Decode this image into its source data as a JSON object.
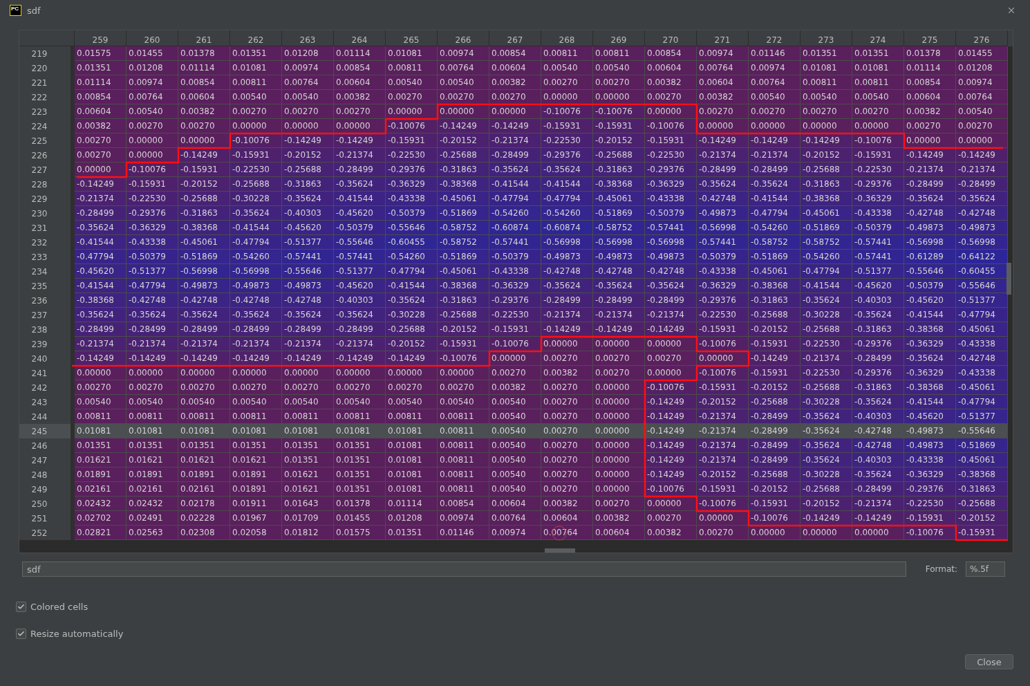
{
  "window": {
    "logo_text": "PC",
    "title": "sdf"
  },
  "table": {
    "columns": [
      "259",
      "260",
      "261",
      "262",
      "263",
      "264",
      "265",
      "266",
      "267",
      "268",
      "269",
      "270",
      "271",
      "272",
      "273",
      "274",
      "275",
      "276"
    ],
    "rows": [
      {
        "label": "219",
        "selected": false,
        "cells": [
          "0.01575",
          "0.01455",
          "0.01378",
          "0.01351",
          "0.01208",
          "0.01114",
          "0.01081",
          "0.00974",
          "0.00854",
          "0.00811",
          "0.00811",
          "0.00854",
          "0.00974",
          "0.01146",
          "0.01351",
          "0.01351",
          "0.01378",
          "0.01455"
        ]
      },
      {
        "label": "220",
        "selected": false,
        "cells": [
          "0.01351",
          "0.01208",
          "0.01114",
          "0.01081",
          "0.00974",
          "0.00854",
          "0.00811",
          "0.00764",
          "0.00604",
          "0.00540",
          "0.00540",
          "0.00604",
          "0.00764",
          "0.00974",
          "0.01081",
          "0.01081",
          "0.01114",
          "0.01208"
        ]
      },
      {
        "label": "221",
        "selected": false,
        "cells": [
          "0.01114",
          "0.00974",
          "0.00854",
          "0.00811",
          "0.00764",
          "0.00604",
          "0.00540",
          "0.00540",
          "0.00382",
          "0.00270",
          "0.00270",
          "0.00382",
          "0.00604",
          "0.00764",
          "0.00811",
          "0.00811",
          "0.00854",
          "0.00974"
        ]
      },
      {
        "label": "222",
        "selected": false,
        "cells": [
          "0.00854",
          "0.00764",
          "0.00604",
          "0.00540",
          "0.00540",
          "0.00382",
          "0.00270",
          "0.00270",
          "0.00270",
          "0.00000",
          "0.00000",
          "0.00270",
          "0.00382",
          "0.00540",
          "0.00540",
          "0.00540",
          "0.00604",
          "0.00764"
        ]
      },
      {
        "label": "223",
        "selected": false,
        "cells": [
          "0.00604",
          "0.00540",
          "0.00382",
          "0.00270",
          "0.00270",
          "0.00270",
          "0.00000",
          "0.00000",
          "0.00000",
          "-0.10076",
          "-0.10076",
          "0.00000",
          "0.00270",
          "0.00270",
          "0.00270",
          "0.00270",
          "0.00382",
          "0.00540"
        ]
      },
      {
        "label": "224",
        "selected": false,
        "cells": [
          "0.00382",
          "0.00270",
          "0.00270",
          "0.00000",
          "0.00000",
          "0.00000",
          "-0.10076",
          "-0.14249",
          "-0.14249",
          "-0.15931",
          "-0.15931",
          "-0.10076",
          "0.00000",
          "0.00000",
          "0.00000",
          "0.00000",
          "0.00270",
          "0.00270"
        ]
      },
      {
        "label": "225",
        "selected": false,
        "cells": [
          "0.00270",
          "0.00000",
          "0.00000",
          "-0.10076",
          "-0.14249",
          "-0.14249",
          "-0.15931",
          "-0.20152",
          "-0.21374",
          "-0.22530",
          "-0.20152",
          "-0.15931",
          "-0.14249",
          "-0.14249",
          "-0.14249",
          "-0.10076",
          "0.00000",
          "0.00000"
        ]
      },
      {
        "label": "226",
        "selected": false,
        "cells": [
          "0.00270",
          "0.00000",
          "-0.14249",
          "-0.15931",
          "-0.20152",
          "-0.21374",
          "-0.22530",
          "-0.25688",
          "-0.28499",
          "-0.29376",
          "-0.25688",
          "-0.22530",
          "-0.21374",
          "-0.21374",
          "-0.20152",
          "-0.15931",
          "-0.14249",
          "-0.14249"
        ]
      },
      {
        "label": "227",
        "selected": false,
        "cells": [
          "0.00000",
          "-0.10076",
          "-0.15931",
          "-0.22530",
          "-0.25688",
          "-0.28499",
          "-0.29376",
          "-0.31863",
          "-0.35624",
          "-0.35624",
          "-0.31863",
          "-0.29376",
          "-0.28499",
          "-0.28499",
          "-0.25688",
          "-0.22530",
          "-0.21374",
          "-0.21374"
        ]
      },
      {
        "label": "228",
        "selected": false,
        "cells": [
          "-0.14249",
          "-0.15931",
          "-0.20152",
          "-0.25688",
          "-0.31863",
          "-0.35624",
          "-0.36329",
          "-0.38368",
          "-0.41544",
          "-0.41544",
          "-0.38368",
          "-0.36329",
          "-0.35624",
          "-0.35624",
          "-0.31863",
          "-0.29376",
          "-0.28499",
          "-0.28499"
        ]
      },
      {
        "label": "229",
        "selected": false,
        "cells": [
          "-0.21374",
          "-0.22530",
          "-0.25688",
          "-0.30228",
          "-0.35624",
          "-0.41544",
          "-0.43338",
          "-0.45061",
          "-0.47794",
          "-0.47794",
          "-0.45061",
          "-0.43338",
          "-0.42748",
          "-0.41544",
          "-0.38368",
          "-0.36329",
          "-0.35624",
          "-0.35624"
        ]
      },
      {
        "label": "230",
        "selected": false,
        "cells": [
          "-0.28499",
          "-0.29376",
          "-0.31863",
          "-0.35624",
          "-0.40303",
          "-0.45620",
          "-0.50379",
          "-0.51869",
          "-0.54260",
          "-0.54260",
          "-0.51869",
          "-0.50379",
          "-0.49873",
          "-0.47794",
          "-0.45061",
          "-0.43338",
          "-0.42748",
          "-0.42748"
        ]
      },
      {
        "label": "231",
        "selected": false,
        "cells": [
          "-0.35624",
          "-0.36329",
          "-0.38368",
          "-0.41544",
          "-0.45620",
          "-0.50379",
          "-0.55646",
          "-0.58752",
          "-0.60874",
          "-0.60874",
          "-0.58752",
          "-0.57441",
          "-0.56998",
          "-0.54260",
          "-0.51869",
          "-0.50379",
          "-0.49873",
          "-0.49873"
        ]
      },
      {
        "label": "232",
        "selected": false,
        "cells": [
          "-0.41544",
          "-0.43338",
          "-0.45061",
          "-0.47794",
          "-0.51377",
          "-0.55646",
          "-0.60455",
          "-0.58752",
          "-0.57441",
          "-0.56998",
          "-0.56998",
          "-0.56998",
          "-0.57441",
          "-0.58752",
          "-0.58752",
          "-0.57441",
          "-0.56998",
          "-0.56998"
        ]
      },
      {
        "label": "233",
        "selected": false,
        "cells": [
          "-0.47794",
          "-0.50379",
          "-0.51869",
          "-0.54260",
          "-0.57441",
          "-0.57441",
          "-0.54260",
          "-0.51869",
          "-0.50379",
          "-0.49873",
          "-0.49873",
          "-0.49873",
          "-0.50379",
          "-0.51869",
          "-0.54260",
          "-0.57441",
          "-0.61289",
          "-0.64122"
        ]
      },
      {
        "label": "234",
        "selected": false,
        "cells": [
          "-0.45620",
          "-0.51377",
          "-0.56998",
          "-0.56998",
          "-0.55646",
          "-0.51377",
          "-0.47794",
          "-0.45061",
          "-0.43338",
          "-0.42748",
          "-0.42748",
          "-0.42748",
          "-0.43338",
          "-0.45061",
          "-0.47794",
          "-0.51377",
          "-0.55646",
          "-0.60455"
        ]
      },
      {
        "label": "235",
        "selected": false,
        "cells": [
          "-0.41544",
          "-0.47794",
          "-0.49873",
          "-0.49873",
          "-0.49873",
          "-0.45620",
          "-0.41544",
          "-0.38368",
          "-0.36329",
          "-0.35624",
          "-0.35624",
          "-0.35624",
          "-0.36329",
          "-0.38368",
          "-0.41544",
          "-0.45620",
          "-0.50379",
          "-0.55646"
        ]
      },
      {
        "label": "236",
        "selected": false,
        "cells": [
          "-0.38368",
          "-0.42748",
          "-0.42748",
          "-0.42748",
          "-0.42748",
          "-0.40303",
          "-0.35624",
          "-0.31863",
          "-0.29376",
          "-0.28499",
          "-0.28499",
          "-0.28499",
          "-0.29376",
          "-0.31863",
          "-0.35624",
          "-0.40303",
          "-0.45620",
          "-0.51377"
        ]
      },
      {
        "label": "237",
        "selected": false,
        "cells": [
          "-0.35624",
          "-0.35624",
          "-0.35624",
          "-0.35624",
          "-0.35624",
          "-0.35624",
          "-0.30228",
          "-0.25688",
          "-0.22530",
          "-0.21374",
          "-0.21374",
          "-0.21374",
          "-0.22530",
          "-0.25688",
          "-0.30228",
          "-0.35624",
          "-0.41544",
          "-0.47794"
        ]
      },
      {
        "label": "238",
        "selected": false,
        "cells": [
          "-0.28499",
          "-0.28499",
          "-0.28499",
          "-0.28499",
          "-0.28499",
          "-0.28499",
          "-0.25688",
          "-0.20152",
          "-0.15931",
          "-0.14249",
          "-0.14249",
          "-0.14249",
          "-0.15931",
          "-0.20152",
          "-0.25688",
          "-0.31863",
          "-0.38368",
          "-0.45061"
        ]
      },
      {
        "label": "239",
        "selected": false,
        "cells": [
          "-0.21374",
          "-0.21374",
          "-0.21374",
          "-0.21374",
          "-0.21374",
          "-0.21374",
          "-0.20152",
          "-0.15931",
          "-0.10076",
          "0.00000",
          "0.00000",
          "0.00000",
          "-0.10076",
          "-0.15931",
          "-0.22530",
          "-0.29376",
          "-0.36329",
          "-0.43338"
        ]
      },
      {
        "label": "240",
        "selected": false,
        "cells": [
          "-0.14249",
          "-0.14249",
          "-0.14249",
          "-0.14249",
          "-0.14249",
          "-0.14249",
          "-0.14249",
          "-0.10076",
          "0.00000",
          "0.00270",
          "0.00270",
          "0.00270",
          "0.00000",
          "-0.14249",
          "-0.21374",
          "-0.28499",
          "-0.35624",
          "-0.42748"
        ]
      },
      {
        "label": "241",
        "selected": false,
        "cells": [
          "0.00000",
          "0.00000",
          "0.00000",
          "0.00000",
          "0.00000",
          "0.00000",
          "0.00000",
          "0.00000",
          "0.00270",
          "0.00382",
          "0.00270",
          "0.00000",
          "-0.10076",
          "-0.15931",
          "-0.22530",
          "-0.29376",
          "-0.36329",
          "-0.43338"
        ]
      },
      {
        "label": "242",
        "selected": false,
        "cells": [
          "0.00270",
          "0.00270",
          "0.00270",
          "0.00270",
          "0.00270",
          "0.00270",
          "0.00270",
          "0.00270",
          "0.00382",
          "0.00270",
          "0.00000",
          "-0.10076",
          "-0.15931",
          "-0.20152",
          "-0.25688",
          "-0.31863",
          "-0.38368",
          "-0.45061"
        ]
      },
      {
        "label": "243",
        "selected": false,
        "cells": [
          "0.00540",
          "0.00540",
          "0.00540",
          "0.00540",
          "0.00540",
          "0.00540",
          "0.00540",
          "0.00540",
          "0.00540",
          "0.00270",
          "0.00000",
          "-0.14249",
          "-0.20152",
          "-0.25688",
          "-0.30228",
          "-0.35624",
          "-0.41544",
          "-0.47794"
        ]
      },
      {
        "label": "244",
        "selected": false,
        "cells": [
          "0.00811",
          "0.00811",
          "0.00811",
          "0.00811",
          "0.00811",
          "0.00811",
          "0.00811",
          "0.00811",
          "0.00540",
          "0.00270",
          "0.00000",
          "-0.14249",
          "-0.21374",
          "-0.28499",
          "-0.35624",
          "-0.40303",
          "-0.45620",
          "-0.51377"
        ]
      },
      {
        "label": "245",
        "selected": true,
        "cells": [
          "0.01081",
          "0.01081",
          "0.01081",
          "0.01081",
          "0.01081",
          "0.01081",
          "0.01081",
          "0.00811",
          "0.00540",
          "0.00270",
          "0.00000",
          "-0.14249",
          "-0.21374",
          "-0.28499",
          "-0.35624",
          "-0.42748",
          "-0.49873",
          "-0.55646"
        ]
      },
      {
        "label": "246",
        "selected": false,
        "cells": [
          "0.01351",
          "0.01351",
          "0.01351",
          "0.01351",
          "0.01351",
          "0.01351",
          "0.01081",
          "0.00811",
          "0.00540",
          "0.00270",
          "0.00000",
          "-0.14249",
          "-0.21374",
          "-0.28499",
          "-0.35624",
          "-0.42748",
          "-0.49873",
          "-0.51869"
        ]
      },
      {
        "label": "247",
        "selected": false,
        "cells": [
          "0.01621",
          "0.01621",
          "0.01621",
          "0.01621",
          "0.01351",
          "0.01351",
          "0.01081",
          "0.00811",
          "0.00540",
          "0.00270",
          "0.00000",
          "-0.14249",
          "-0.21374",
          "-0.28499",
          "-0.35624",
          "-0.40303",
          "-0.43338",
          "-0.45061"
        ]
      },
      {
        "label": "248",
        "selected": false,
        "cells": [
          "0.01891",
          "0.01891",
          "0.01891",
          "0.01891",
          "0.01621",
          "0.01351",
          "0.01081",
          "0.00811",
          "0.00540",
          "0.00270",
          "0.00000",
          "-0.14249",
          "-0.20152",
          "-0.25688",
          "-0.30228",
          "-0.35624",
          "-0.36329",
          "-0.38368"
        ]
      },
      {
        "label": "249",
        "selected": false,
        "cells": [
          "0.02161",
          "0.02161",
          "0.02161",
          "0.01891",
          "0.01621",
          "0.01351",
          "0.01081",
          "0.00811",
          "0.00540",
          "0.00270",
          "0.00000",
          "-0.10076",
          "-0.15931",
          "-0.20152",
          "-0.25688",
          "-0.28499",
          "-0.29376",
          "-0.31863"
        ]
      },
      {
        "label": "250",
        "selected": false,
        "cells": [
          "0.02432",
          "0.02432",
          "0.02178",
          "0.01911",
          "0.01643",
          "0.01378",
          "0.01114",
          "0.00854",
          "0.00604",
          "0.00382",
          "0.00270",
          "0.00000",
          "-0.10076",
          "-0.15931",
          "-0.20152",
          "-0.21374",
          "-0.22530",
          "-0.25688"
        ]
      },
      {
        "label": "251",
        "selected": false,
        "cells": [
          "0.02702",
          "0.02491",
          "0.02228",
          "0.01967",
          "0.01709",
          "0.01455",
          "0.01208",
          "0.00974",
          "0.00764",
          "0.00604",
          "0.00382",
          "0.00270",
          "0.00000",
          "-0.10076",
          "-0.14249",
          "-0.14249",
          "-0.15931",
          "-0.20152"
        ]
      },
      {
        "label": "252",
        "selected": false,
        "cells": [
          "0.02821",
          "0.02563",
          "0.02308",
          "0.02058",
          "0.01812",
          "0.01575",
          "0.01351",
          "0.01146",
          "0.00974",
          "0.00764",
          "0.00604",
          "0.00382",
          "0.00270",
          "0.00000",
          "0.00000",
          "0.00000",
          "-0.10076",
          "-0.15931"
        ]
      }
    ]
  },
  "name_field": {
    "value": "sdf"
  },
  "format": {
    "label": "Format:",
    "value": "%.5f"
  },
  "options": [
    {
      "label": "Colored cells",
      "checked": true
    },
    {
      "label": "Resize automatically",
      "checked": true
    }
  ],
  "buttons": [
    "Close"
  ]
}
